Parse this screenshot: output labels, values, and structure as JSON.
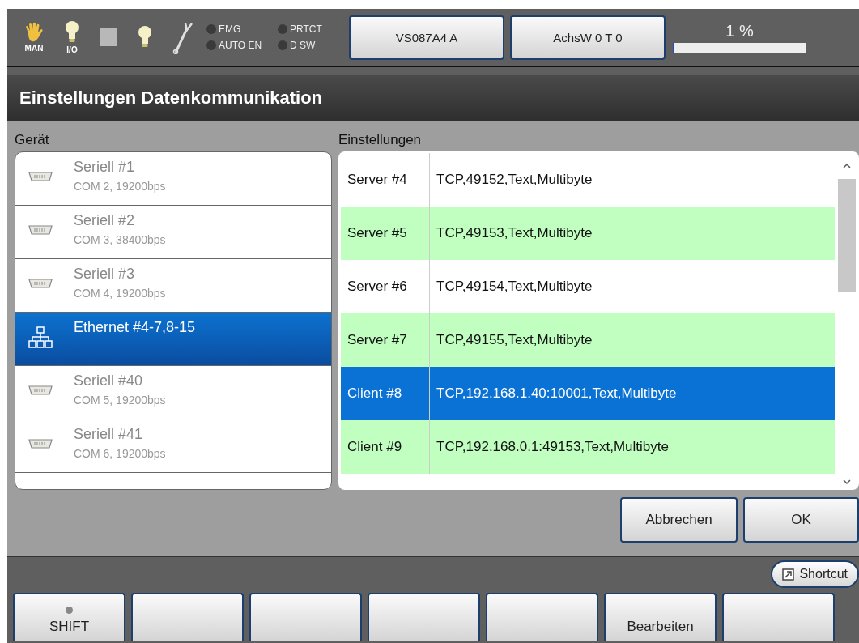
{
  "status_bar": {
    "mode_icons": [
      {
        "kind": "hand",
        "label": "MAN"
      },
      {
        "kind": "bulb",
        "label": "I/O"
      },
      {
        "kind": "square"
      },
      {
        "kind": "bulb"
      },
      {
        "kind": "wrench"
      }
    ],
    "indicators": [
      {
        "label": "EMG",
        "on": false
      },
      {
        "label": "PRTCT",
        "on": false
      },
      {
        "label": "AUTO EN",
        "on": false
      },
      {
        "label": "D SW",
        "on": false
      }
    ],
    "buttons": [
      "VS087A4 A",
      "AchsW 0 T 0"
    ],
    "progress": {
      "reading": "1 %",
      "level": 0.01
    }
  },
  "title": "Einstellungen Datenkommunikation",
  "devices": {
    "heading": "Gerät",
    "items": [
      {
        "kind": "serial",
        "name": "Seriell #1",
        "detail": "COM 2, 19200bps",
        "selected": false
      },
      {
        "kind": "serial",
        "name": "Seriell #2",
        "detail": "COM 3, 38400bps",
        "selected": false
      },
      {
        "kind": "serial",
        "name": "Seriell #3",
        "detail": "COM 4, 19200bps",
        "selected": false
      },
      {
        "kind": "ethernet",
        "name": "Ethernet #4-7,8-15",
        "selected": true
      },
      {
        "kind": "serial",
        "name": "Seriell #40",
        "detail": "COM 5, 19200bps",
        "selected": false
      },
      {
        "kind": "serial",
        "name": "Seriell #41",
        "detail": "COM 6, 19200bps",
        "selected": false
      }
    ]
  },
  "settings": {
    "heading": "Einstellungen",
    "rows": [
      {
        "name": "Server #4",
        "value": "TCP,49152,Text,Multibyte",
        "selected": false
      },
      {
        "name": "Server #5",
        "value": "TCP,49153,Text,Multibyte",
        "selected": false
      },
      {
        "name": "Server #6",
        "value": "TCP,49154,Text,Multibyte",
        "selected": false
      },
      {
        "name": "Server #7",
        "value": "TCP,49155,Text,Multibyte",
        "selected": false
      },
      {
        "name": "Client #8",
        "value": "TCP,192.168.1.40:10001,Text,Multibyte",
        "selected": true
      },
      {
        "name": "Client #9",
        "value": "TCP,192.168.0.1:49153,Text,Multibyte",
        "selected": false
      }
    ]
  },
  "dialog_buttons": [
    "Abbrechen",
    "OK"
  ],
  "shortcut": "Shortcut",
  "function_keys": [
    {
      "kind": "lamp",
      "label": "SHIFT",
      "lamp_on": false
    },
    {
      "kind": "blank"
    },
    {
      "kind": "blank"
    },
    {
      "kind": "blank"
    },
    {
      "kind": "blank"
    },
    {
      "kind": "text",
      "label": "Bearbeiten"
    },
    {
      "kind": "blank"
    }
  ]
}
